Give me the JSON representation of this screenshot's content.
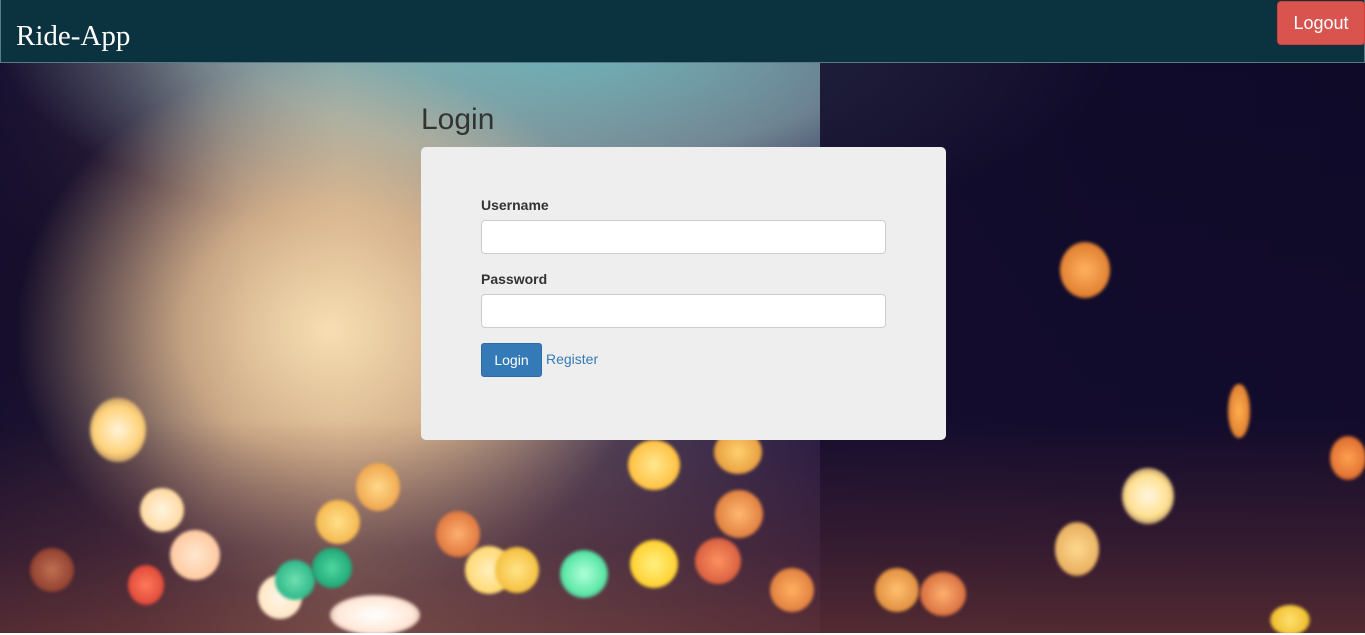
{
  "navbar": {
    "brand": "Ride-App",
    "logout_label": "Logout"
  },
  "login": {
    "title": "Login",
    "username_label": "Username",
    "username_value": "",
    "password_label": "Password",
    "password_value": "",
    "submit_label": "Login",
    "register_label": "Register"
  },
  "colors": {
    "navbar_bg": "#0b323f",
    "logout_bg": "#d9534f",
    "primary": "#337ab7",
    "card_bg": "#eeeeee"
  },
  "icons": []
}
